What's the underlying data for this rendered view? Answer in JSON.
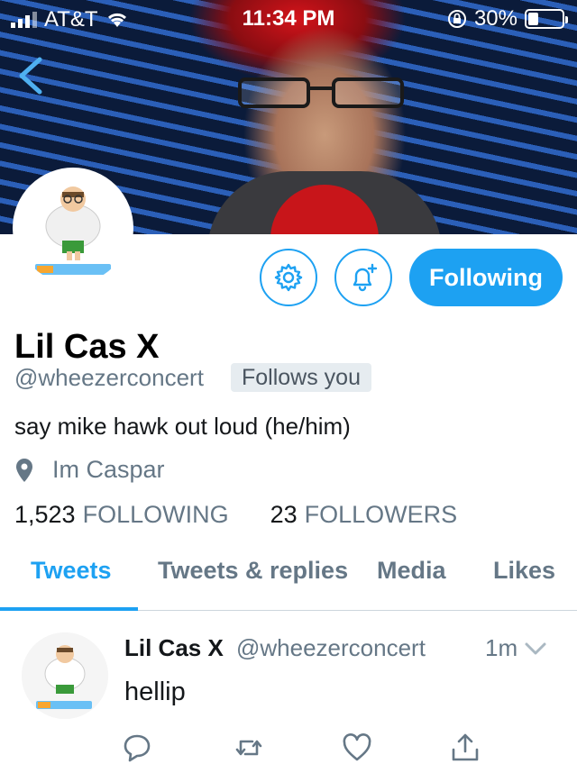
{
  "status_bar": {
    "carrier": "AT&T",
    "time": "11:34 PM",
    "battery": "30%",
    "battery_level": 0.3
  },
  "profile": {
    "name": "Lil Cas X",
    "handle": "@wheezerconcert",
    "follows_you_badge": "Follows you",
    "bio": "say mike hawk out loud (he/him)",
    "location": "Im Caspar",
    "following_count": "1,523",
    "following_label": "FOLLOWING",
    "followers_count": "23",
    "followers_label": "FOLLOWERS",
    "follow_button_label": "Following"
  },
  "tabs": [
    {
      "label": "Tweets",
      "active": true
    },
    {
      "label": "Tweets & replies",
      "active": false
    },
    {
      "label": "Media",
      "active": false
    },
    {
      "label": "Likes",
      "active": false
    }
  ],
  "tweet": {
    "name": "Lil Cas X",
    "handle": "@wheezerconcert",
    "time": "1m",
    "text": "hellip"
  },
  "icons": {
    "back": "chevron-left-icon",
    "settings": "gear-icon",
    "notifications": "bell-plus-icon",
    "location": "map-pin-icon",
    "reply": "speech-bubble-icon",
    "retweet": "retweet-icon",
    "like": "heart-icon",
    "share": "share-icon"
  },
  "colors": {
    "accent": "#1da1f2",
    "secondary_text": "#657786",
    "primary_text": "#14171a"
  }
}
